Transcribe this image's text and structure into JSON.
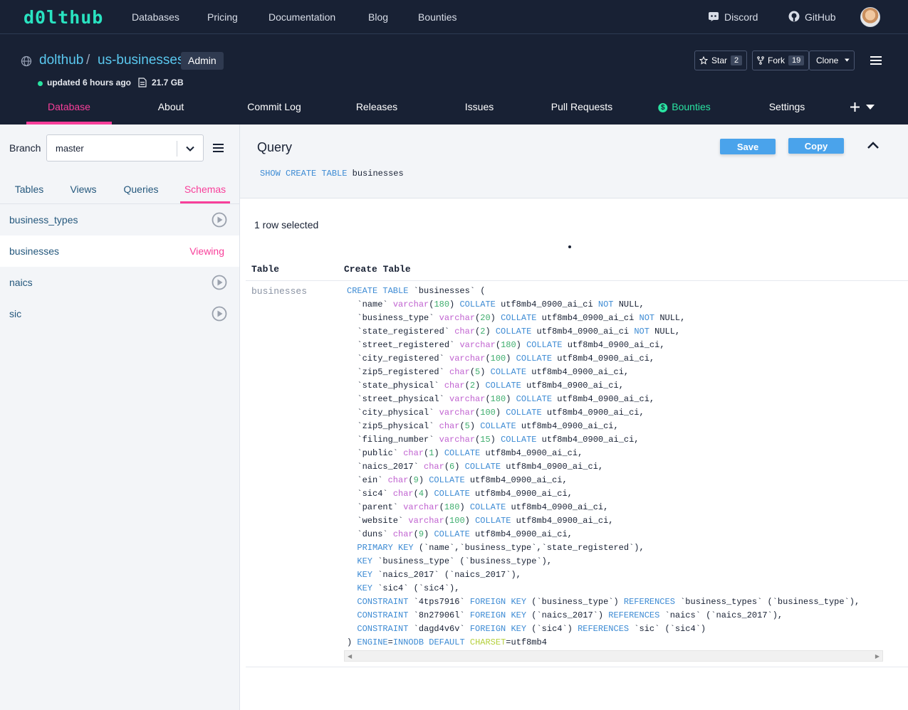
{
  "topnav": {
    "logo": "d0lthub",
    "links": [
      "Databases",
      "Pricing",
      "Documentation",
      "Blog",
      "Bounties"
    ],
    "discord": "Discord",
    "github": "GitHub"
  },
  "repo": {
    "owner": "dolthub",
    "separator": "/",
    "name": "us-businesses",
    "badge": "Admin",
    "updated": "updated 6 hours ago",
    "size": "21.7 GB",
    "star_label": "Star",
    "star_count": "2",
    "fork_label": "Fork",
    "fork_count": "19",
    "clone_label": "Clone"
  },
  "tabs": {
    "database": "Database",
    "about": "About",
    "commit_log": "Commit Log",
    "releases": "Releases",
    "issues": "Issues",
    "pull_requests": "Pull Requests",
    "bounties": "Bounties",
    "settings": "Settings"
  },
  "sidebar": {
    "branch_label": "Branch",
    "branch_value": "master",
    "tabs": [
      "Tables",
      "Views",
      "Queries",
      "Schemas"
    ],
    "active_tab": "Schemas",
    "items": [
      {
        "name": "business_types",
        "status": ""
      },
      {
        "name": "businesses",
        "status": "Viewing"
      },
      {
        "name": "naics",
        "status": ""
      },
      {
        "name": "sic",
        "status": ""
      }
    ]
  },
  "query": {
    "title": "Query",
    "sql_kw1": "SHOW",
    "sql_kw2": "CREATE",
    "sql_kw3": "TABLE",
    "sql_table": "businesses",
    "save_label": "Save",
    "copy_label": "Copy"
  },
  "result": {
    "rows_selected": "1 row selected",
    "columns": [
      "Table",
      "Create Table"
    ],
    "table_value": "businesses"
  },
  "colors": {
    "nav_bg": "#182134",
    "accent_pink": "#f83f9a",
    "accent_teal": "#29e3c1",
    "link_blue": "#5ac8ef",
    "button_blue": "#4aa3eb",
    "sql_keyword": "#3d8bd4",
    "sql_type": "#c062d0",
    "sql_number": "#3fae6e"
  }
}
